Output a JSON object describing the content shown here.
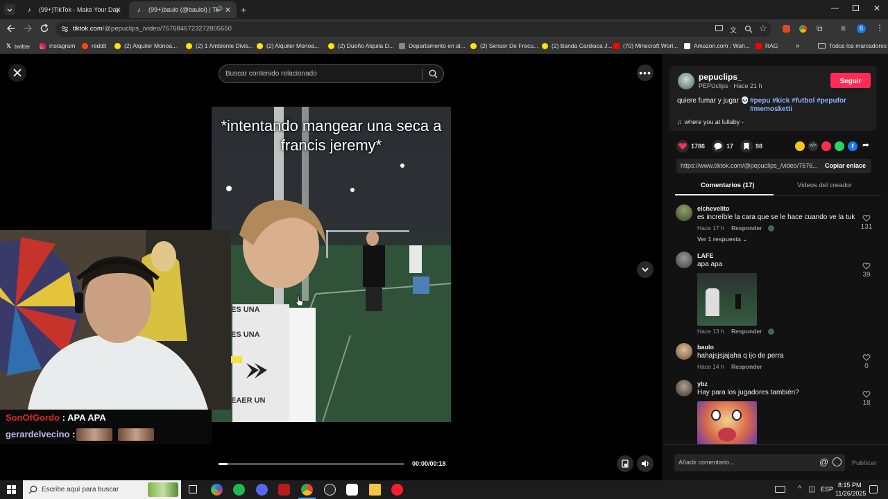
{
  "tabs": [
    {
      "title": "(99+)TikTok - Make Your Day"
    },
    {
      "title": "(99+)baulo (@baulol) | TikTok"
    }
  ],
  "url": {
    "domain": "tiktok.com",
    "path": "/@pepuclips_/video/7576846723272805650"
  },
  "bookmarks": [
    "twitter",
    "instagram",
    "reddit",
    "(2) Alquiler Monoa...",
    "(2) 1 Ambiente Divis...",
    "(2) Alquiler Monoa...",
    "(2) Dueño Alquila D...",
    "Departamento en al...",
    "(2) Sensor De Frecu...",
    "(2) Banda Cardiaca J...",
    "(70) Minecraft Worl...",
    "Amazon.com : Wah...",
    "RAG",
    "Todos los marcadores"
  ],
  "search": {
    "placeholder": "Buscar contenido relacionado"
  },
  "video": {
    "caption": "*intentando mangear una seca a francis jeremy*",
    "overlay_lines": [
      "ES UNA",
      "ES UNA",
      "EAER UN"
    ],
    "time": "00:00/00:18",
    "progress": 0.05
  },
  "stream_chat": [
    {
      "user": "SonOfGordo",
      "sep": ":",
      "message": "APA APA",
      "color": "#e0242a"
    },
    {
      "user": "gerardelvecino",
      "sep": ":",
      "message": "",
      "color": "#b8bde6"
    }
  ],
  "creator": {
    "handle": "pepuclips_",
    "subline": "PEPUclips · Hace 21 h",
    "follow_label": "Seguir",
    "description": "quiere fumar y jugar 💀",
    "hashtags": "#pepu #kick #futbol #pepufor #memosketti",
    "music": "where you at lullaby -"
  },
  "stats": {
    "likes": "1786",
    "comments": "17",
    "saves": "98"
  },
  "share": {
    "url": "https://www.tiktok.com/@pepuclips_/video/7576...",
    "copy_label": "Copiar enlace"
  },
  "tabs_panel": {
    "comments": "Comentarios (17)",
    "creator_videos": "Videos del creador"
  },
  "comments": [
    {
      "user": "elchevelito",
      "text": "es increíble la cara que se le hace cuando ve la tuk",
      "time": "Hace 17 h",
      "reply": "Responder",
      "likes": "131",
      "replies_label": "Ver 1 respuesta"
    },
    {
      "user": "LAFE",
      "text": "apa apa",
      "time": "Hace 13 h",
      "reply": "Responder",
      "likes": "39"
    },
    {
      "user": "baulo",
      "text": "hahajsjsjajaha q ijo de perra",
      "time": "Hace 14 h",
      "reply": "Responder",
      "likes": "0"
    },
    {
      "user": "ybz",
      "text": "Hay para los jugadores también?",
      "likes": "18"
    }
  ],
  "comment_input": {
    "placeholder": "Añadir comentario...",
    "publish": "Publicar"
  },
  "taskbar": {
    "search_placeholder": "Escribe aquí para buscar",
    "lang": "ESP",
    "time": "8:15 PM",
    "date": "11/26/2025"
  },
  "colors": {
    "accent": "#fe2c55",
    "hashtag": "#8ab4f8"
  }
}
